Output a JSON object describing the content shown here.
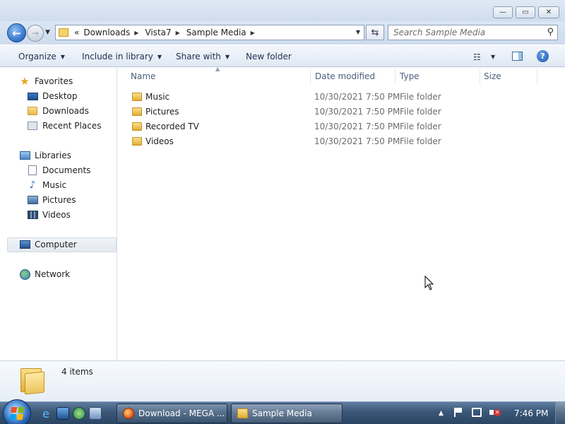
{
  "window": {
    "minimize_glyph": "—",
    "maximize_glyph": "▭",
    "close_glyph": "✕"
  },
  "navbar": {
    "breadcrumb_prefix": "«",
    "breadcrumb": [
      "Downloads",
      "Vista7",
      "Sample Media"
    ],
    "search_placeholder": "Search Sample Media"
  },
  "toolbar": {
    "organize": "Organize",
    "include_in_library": "Include in library",
    "share_with": "Share with",
    "new_folder": "New folder"
  },
  "nav_pane": {
    "favorites": {
      "label": "Favorites",
      "items": [
        "Desktop",
        "Downloads",
        "Recent Places"
      ]
    },
    "libraries": {
      "label": "Libraries",
      "items": [
        "Documents",
        "Music",
        "Pictures",
        "Videos"
      ]
    },
    "computer": "Computer",
    "network": "Network"
  },
  "columns": {
    "name": "Name",
    "date_modified": "Date modified",
    "type": "Type",
    "size": "Size"
  },
  "files": [
    {
      "name": "Music",
      "date": "10/30/2021 7:50 PM",
      "type": "File folder"
    },
    {
      "name": "Pictures",
      "date": "10/30/2021 7:50 PM",
      "type": "File folder"
    },
    {
      "name": "Recorded TV",
      "date": "10/30/2021 7:50 PM",
      "type": "File folder"
    },
    {
      "name": "Videos",
      "date": "10/30/2021 7:50 PM",
      "type": "File folder"
    }
  ],
  "details": {
    "items_count": "4 items"
  },
  "taskbar": {
    "tasks": [
      {
        "label": "Download - MEGA ..."
      },
      {
        "label": "Sample Media"
      }
    ],
    "clock": "7:46 PM"
  },
  "colors": {
    "accent": "#2f6fc8",
    "folder": "#f5d26a",
    "taskbar": "#3b5777"
  },
  "icons": {
    "back": "back-arrow-icon",
    "forward": "forward-arrow-icon",
    "search": "search-icon",
    "refresh": "refresh-icon",
    "help": "help-icon"
  }
}
